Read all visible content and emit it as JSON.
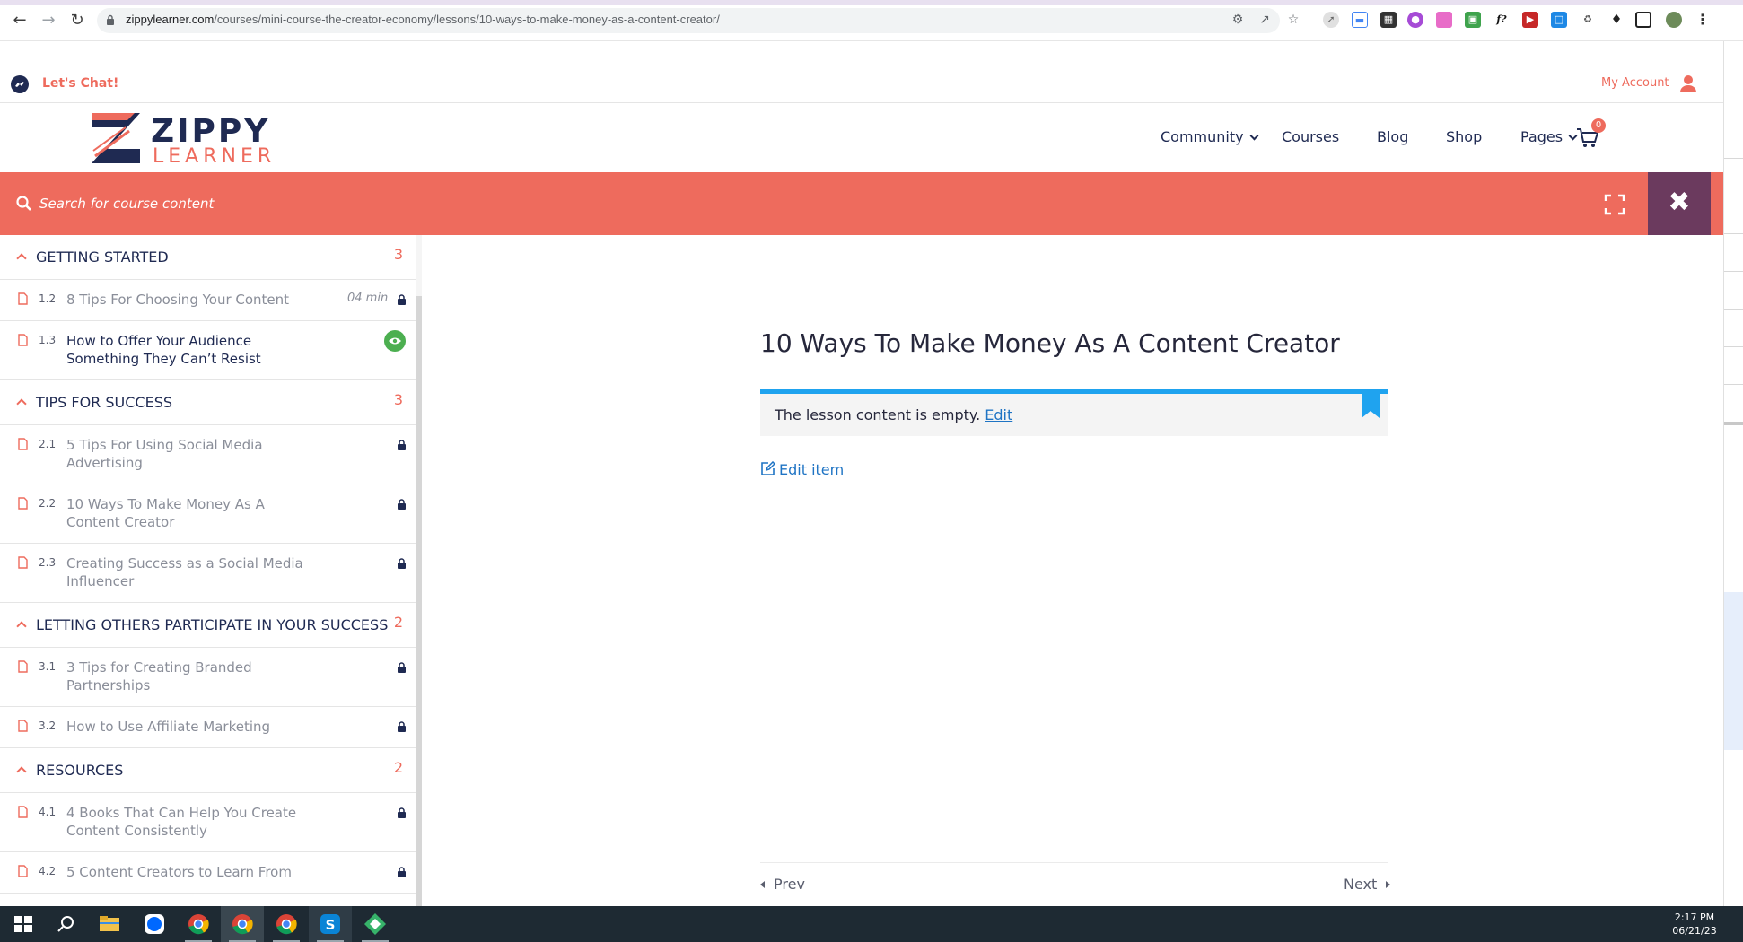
{
  "browser": {
    "url_host": "zippylearner.com",
    "url_path": "/courses/mini-course-the-creator-economy/lessons/10-ways-to-make-money-as-a-content-creator/"
  },
  "topbar": {
    "chat_label": "Let's Chat!",
    "account_label": "My Account"
  },
  "logo": {
    "line1": "ZIPPY",
    "line2": "LEARNER"
  },
  "menu": {
    "community": "Community",
    "courses": "Courses",
    "blog": "Blog",
    "shop": "Shop",
    "pages": "Pages",
    "cart_count": "0"
  },
  "search": {
    "placeholder": "Search for course content"
  },
  "curriculum": {
    "sections": [
      {
        "title": "GETTING STARTED",
        "count": "3",
        "lessons": [
          {
            "num": "1.2",
            "title": "8 Tips For Choosing Your Content",
            "duration": "04 min",
            "status": "locked"
          },
          {
            "num": "1.3",
            "title": "How to Offer Your Audience Something They Can’t Resist",
            "status": "preview"
          }
        ]
      },
      {
        "title": "TIPS FOR SUCCESS",
        "count": "3",
        "lessons": [
          {
            "num": "2.1",
            "title": "5 Tips For Using Social Media Advertising",
            "status": "locked"
          },
          {
            "num": "2.2",
            "title": "10 Ways To Make Money As A Content Creator",
            "status": "locked"
          },
          {
            "num": "2.3",
            "title": "Creating Success as a Social Media Influencer",
            "status": "locked"
          }
        ]
      },
      {
        "title": "LETTING OTHERS PARTICIPATE IN YOUR SUCCESS",
        "count": "2",
        "lessons": [
          {
            "num": "3.1",
            "title": "3 Tips for Creating Branded Partnerships",
            "status": "locked"
          },
          {
            "num": "3.2",
            "title": "How to Use Affiliate Marketing",
            "status": "locked"
          }
        ]
      },
      {
        "title": "RESOURCES",
        "count": "2",
        "lessons": [
          {
            "num": "4.1",
            "title": "4 Books That Can Help You Create Content Consistently",
            "status": "locked"
          },
          {
            "num": "4.2",
            "title": "5 Content Creators to Learn From",
            "status": "locked"
          }
        ]
      }
    ]
  },
  "main": {
    "title": "10 Ways To Make Money As A Content Creator",
    "notice_text": "The lesson content is empty.",
    "notice_link": "Edit",
    "edit_item": "Edit item",
    "prev": "Prev",
    "next": "Next"
  },
  "taskbar": {
    "time": "2:17 PM",
    "date": "06/21/23"
  },
  "colors": {
    "accent": "#ee6b5d",
    "navy": "#1f2a52",
    "close_bg": "#6b3a5e",
    "notice_border": "#1fa3ef",
    "preview_green": "#4caf50"
  }
}
